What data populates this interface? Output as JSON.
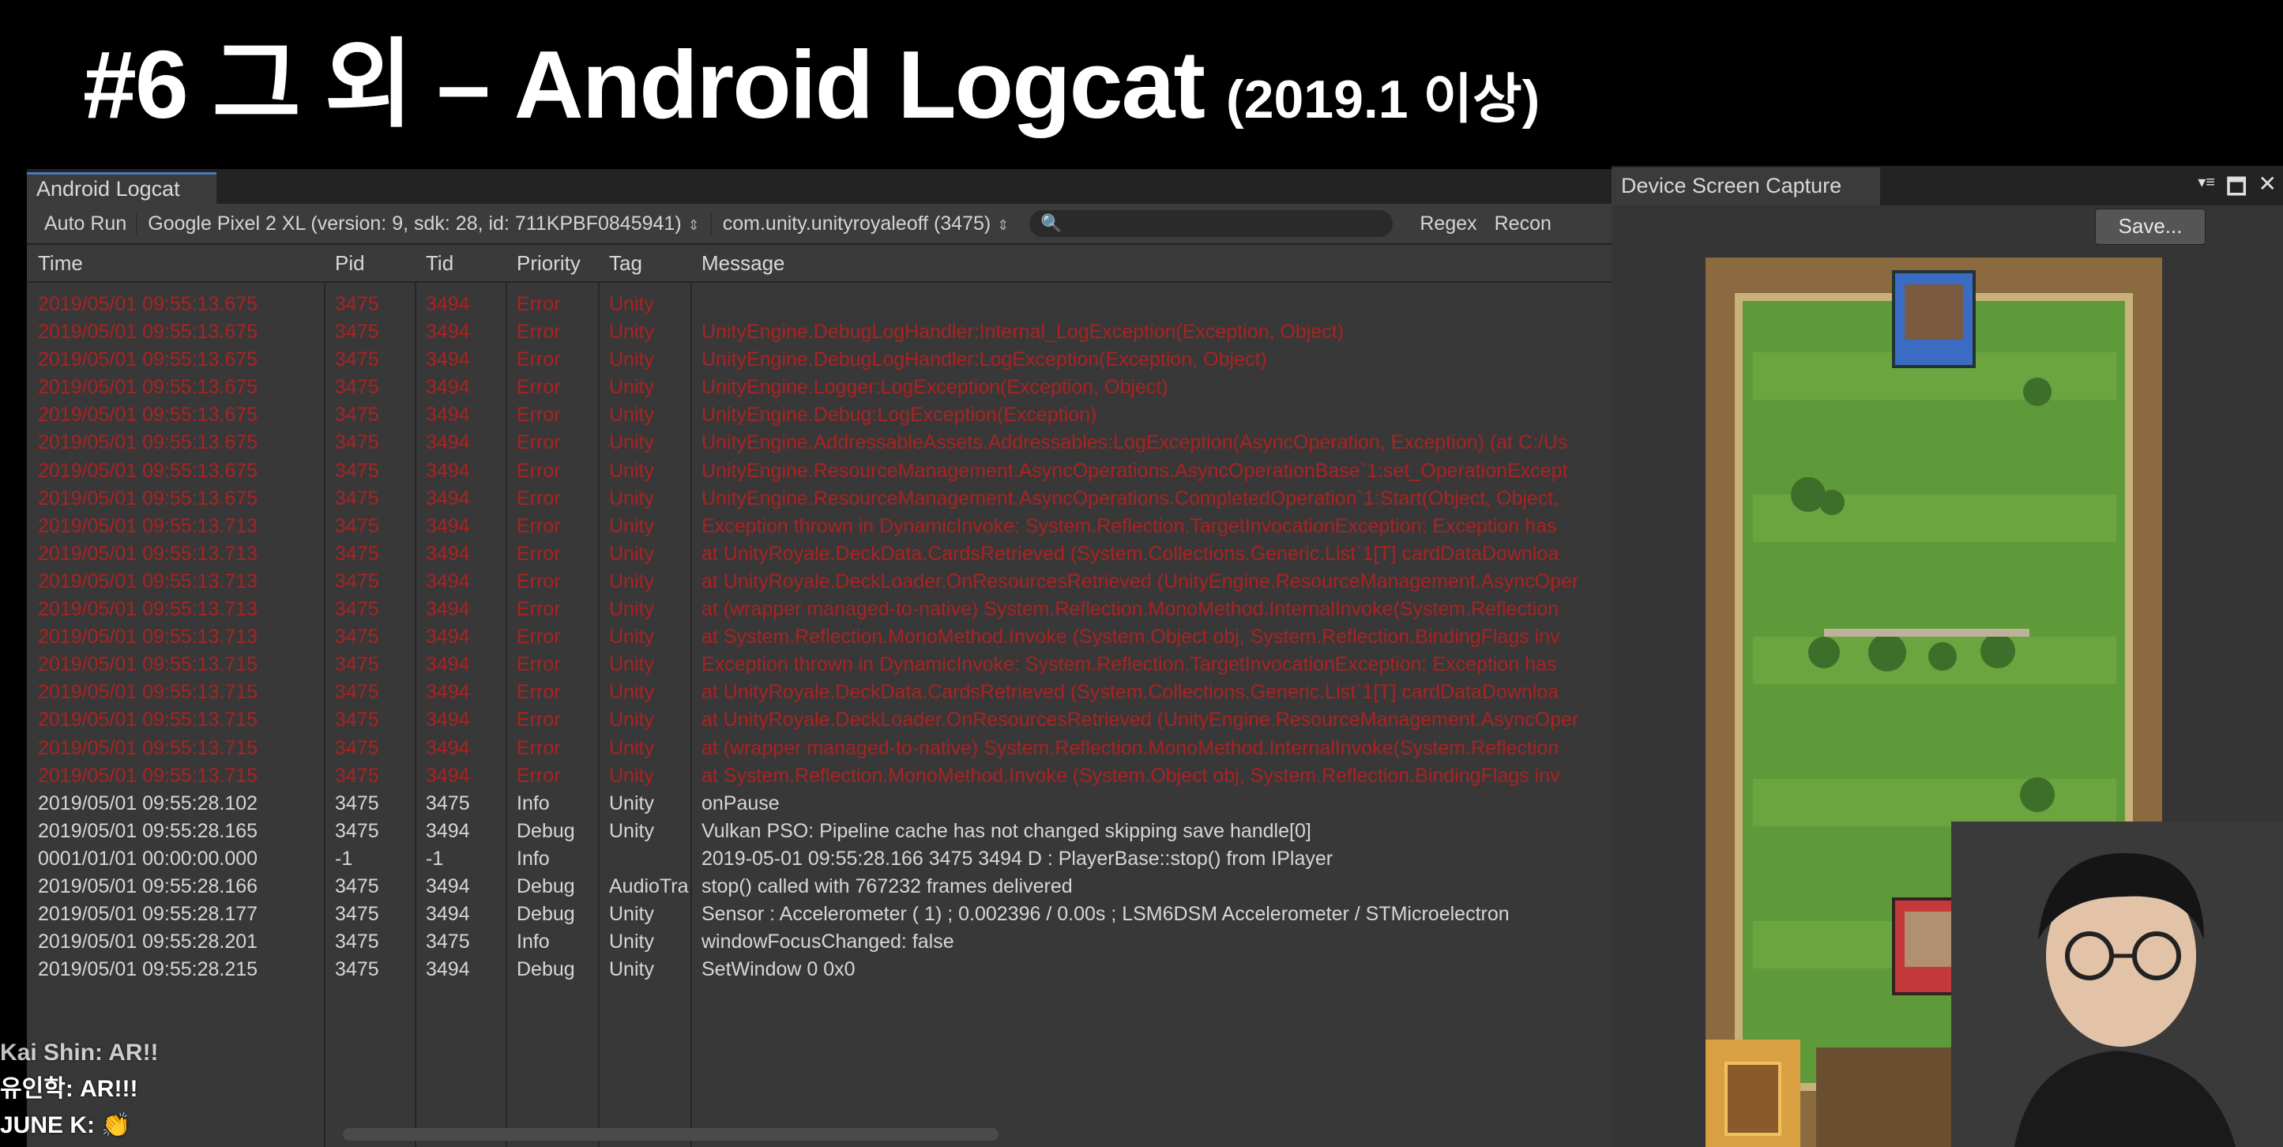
{
  "slide": {
    "title": "#6 그 외 – Android Logcat",
    "subtitle": "(2019.1 이상)"
  },
  "logcat": {
    "tab": "Android Logcat",
    "toolbar": {
      "auto_run": "Auto Run",
      "device": "Google Pixel 2 XL (version: 9, sdk: 28, id: 711KPBF0845941)",
      "package": "com.unity.unityroyaleoff (3475)",
      "search_value": "",
      "regex": "Regex",
      "reconnect": "Recon"
    },
    "columns": [
      "Time",
      "Pid",
      "Tid",
      "Priority",
      "Tag",
      "Message"
    ],
    "rows": [
      {
        "time": "2019/05/01 09:55:13.675",
        "pid": "3475",
        "tid": "3494",
        "priority": "Error",
        "tag": "Unity",
        "message": "",
        "level": "error"
      },
      {
        "time": "2019/05/01 09:55:13.675",
        "pid": "3475",
        "tid": "3494",
        "priority": "Error",
        "tag": "Unity",
        "message": "UnityEngine.DebugLogHandler:Internal_LogException(Exception, Object)",
        "level": "error"
      },
      {
        "time": "2019/05/01 09:55:13.675",
        "pid": "3475",
        "tid": "3494",
        "priority": "Error",
        "tag": "Unity",
        "message": "UnityEngine.DebugLogHandler:LogException(Exception, Object)",
        "level": "error"
      },
      {
        "time": "2019/05/01 09:55:13.675",
        "pid": "3475",
        "tid": "3494",
        "priority": "Error",
        "tag": "Unity",
        "message": "UnityEngine.Logger:LogException(Exception, Object)",
        "level": "error"
      },
      {
        "time": "2019/05/01 09:55:13.675",
        "pid": "3475",
        "tid": "3494",
        "priority": "Error",
        "tag": "Unity",
        "message": "UnityEngine.Debug:LogException(Exception)",
        "level": "error"
      },
      {
        "time": "2019/05/01 09:55:13.675",
        "pid": "3475",
        "tid": "3494",
        "priority": "Error",
        "tag": "Unity",
        "message": "UnityEngine.AddressableAssets.Addressables:LogException(AsyncOperation, Exception) (at C:/Us",
        "level": "error"
      },
      {
        "time": "2019/05/01 09:55:13.675",
        "pid": "3475",
        "tid": "3494",
        "priority": "Error",
        "tag": "Unity",
        "message": "UnityEngine.ResourceManagement.AsyncOperations.AsyncOperationBase`1:set_OperationExcept",
        "level": "error"
      },
      {
        "time": "2019/05/01 09:55:13.675",
        "pid": "3475",
        "tid": "3494",
        "priority": "Error",
        "tag": "Unity",
        "message": "UnityEngine.ResourceManagement.AsyncOperations.CompletedOperation`1:Start(Object, Object,",
        "level": "error"
      },
      {
        "time": "2019/05/01 09:55:13.713",
        "pid": "3475",
        "tid": "3494",
        "priority": "Error",
        "tag": "Unity",
        "message": "Exception thrown in DynamicInvoke: System.Reflection.TargetInvocationException: Exception has",
        "level": "error"
      },
      {
        "time": "2019/05/01 09:55:13.713",
        "pid": "3475",
        "tid": "3494",
        "priority": "Error",
        "tag": "Unity",
        "message": "at UnityRoyale.DeckData.CardsRetrieved (System.Collections.Generic.List`1[T] cardDataDownloa",
        "level": "error"
      },
      {
        "time": "2019/05/01 09:55:13.713",
        "pid": "3475",
        "tid": "3494",
        "priority": "Error",
        "tag": "Unity",
        "message": "at UnityRoyale.DeckLoader.OnResourcesRetrieved (UnityEngine.ResourceManagement.AsyncOper",
        "level": "error"
      },
      {
        "time": "2019/05/01 09:55:13.713",
        "pid": "3475",
        "tid": "3494",
        "priority": "Error",
        "tag": "Unity",
        "message": "at (wrapper managed-to-native) System.Reflection.MonoMethod.InternalInvoke(System.Reflection",
        "level": "error"
      },
      {
        "time": "2019/05/01 09:55:13.713",
        "pid": "3475",
        "tid": "3494",
        "priority": "Error",
        "tag": "Unity",
        "message": "at System.Reflection.MonoMethod.Invoke (System.Object obj, System.Reflection.BindingFlags inv",
        "level": "error"
      },
      {
        "time": "2019/05/01 09:55:13.715",
        "pid": "3475",
        "tid": "3494",
        "priority": "Error",
        "tag": "Unity",
        "message": "Exception thrown in DynamicInvoke: System.Reflection.TargetInvocationException: Exception has",
        "level": "error"
      },
      {
        "time": "2019/05/01 09:55:13.715",
        "pid": "3475",
        "tid": "3494",
        "priority": "Error",
        "tag": "Unity",
        "message": "at UnityRoyale.DeckData.CardsRetrieved (System.Collections.Generic.List`1[T] cardDataDownloa",
        "level": "error"
      },
      {
        "time": "2019/05/01 09:55:13.715",
        "pid": "3475",
        "tid": "3494",
        "priority": "Error",
        "tag": "Unity",
        "message": "at UnityRoyale.DeckLoader.OnResourcesRetrieved (UnityEngine.ResourceManagement.AsyncOper",
        "level": "error"
      },
      {
        "time": "2019/05/01 09:55:13.715",
        "pid": "3475",
        "tid": "3494",
        "priority": "Error",
        "tag": "Unity",
        "message": "at (wrapper managed-to-native) System.Reflection.MonoMethod.InternalInvoke(System.Reflection",
        "level": "error"
      },
      {
        "time": "2019/05/01 09:55:13.715",
        "pid": "3475",
        "tid": "3494",
        "priority": "Error",
        "tag": "Unity",
        "message": "at System.Reflection.MonoMethod.Invoke (System.Object obj, System.Reflection.BindingFlags inv",
        "level": "error"
      },
      {
        "time": "2019/05/01 09:55:28.102",
        "pid": "3475",
        "tid": "3475",
        "priority": "Info",
        "tag": "Unity",
        "message": "onPause",
        "level": "info"
      },
      {
        "time": "2019/05/01 09:55:28.165",
        "pid": "3475",
        "tid": "3494",
        "priority": "Debug",
        "tag": "Unity",
        "message": "Vulkan PSO: Pipeline cache has not changed skipping save handle[0]",
        "level": "debug"
      },
      {
        "time": "0001/01/01 00:00:00.000",
        "pid": "-1",
        "tid": "-1",
        "priority": "Info",
        "tag": "",
        "message": "2019-05-01 09:55:28.166  3475  3494 D          : PlayerBase::stop() from IPlayer",
        "level": "info"
      },
      {
        "time": "2019/05/01 09:55:28.166",
        "pid": "3475",
        "tid": "3494",
        "priority": "Debug",
        "tag": "AudioTra",
        "message": "stop() called with 767232 frames delivered",
        "level": "debug"
      },
      {
        "time": "2019/05/01 09:55:28.177",
        "pid": "3475",
        "tid": "3494",
        "priority": "Debug",
        "tag": "Unity",
        "message": "Sensor :         Accelerometer ( 1) ; 0.002396 / 0.00s ; LSM6DSM Accelerometer / STMicroelectron",
        "level": "debug"
      },
      {
        "time": "2019/05/01 09:55:28.201",
        "pid": "3475",
        "tid": "3475",
        "priority": "Info",
        "tag": "Unity",
        "message": "windowFocusChanged: false",
        "level": "info"
      },
      {
        "time": "2019/05/01 09:55:28.215",
        "pid": "3475",
        "tid": "3494",
        "priority": "Debug",
        "tag": "Unity",
        "message": "SetWindow 0 0x0",
        "level": "debug"
      }
    ]
  },
  "capture": {
    "tab": "Device Screen Capture",
    "save": "Save..."
  },
  "chat": [
    {
      "user": "Kai Shin",
      "text": "AR!!"
    },
    {
      "user": "유인학",
      "text": "AR!!!"
    },
    {
      "user": "JUNE K",
      "text": "👏"
    }
  ],
  "colors": {
    "error": "#b82020",
    "panel": "#383838",
    "accent": "#4a78b8"
  }
}
